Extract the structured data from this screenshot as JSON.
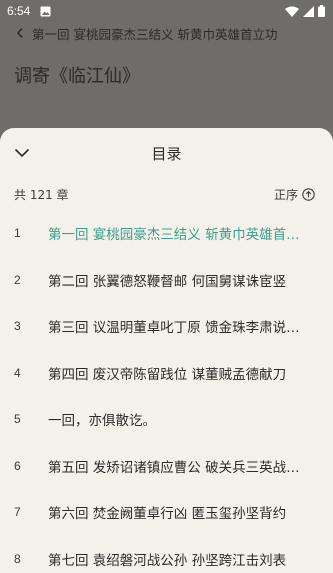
{
  "status_bar": {
    "time": "6:54",
    "icons": [
      "image-icon",
      "wifi-icon",
      "signal-icon",
      "battery-icon"
    ]
  },
  "reader": {
    "chapter_heading": "第一回 宴桃园豪杰三结义 斩黄巾英雄首立功",
    "poem_title": "调寄《临江仙》"
  },
  "toc_sheet": {
    "title": "目录",
    "chapter_count": "共 121 章",
    "sort_label": "正序",
    "active_color": "#3aa18d",
    "chapters": [
      {
        "num": "1",
        "title": "第一回 宴桃园豪杰三结义 斩黄巾英雄首立功"
      },
      {
        "num": "2",
        "title": "第二回 张翼德怒鞭督邮 何国舅谋诛宦竖"
      },
      {
        "num": "3",
        "title": "第三回 议温明董卓叱丁原 馈金珠李肃说吕布"
      },
      {
        "num": "4",
        "title": "第四回 废汉帝陈留践位 谋董贼孟德献刀"
      },
      {
        "num": "5",
        "title": "一回，亦俱散讫。"
      },
      {
        "num": "6",
        "title": "第五回 发矫诏诸镇应曹公 破关兵三英战吕布"
      },
      {
        "num": "7",
        "title": "第六回 焚金阙董卓行凶 匿玉玺孙坚背约"
      },
      {
        "num": "8",
        "title": "第七回 袁绍磐河战公孙 孙坚跨江击刘表"
      }
    ]
  }
}
